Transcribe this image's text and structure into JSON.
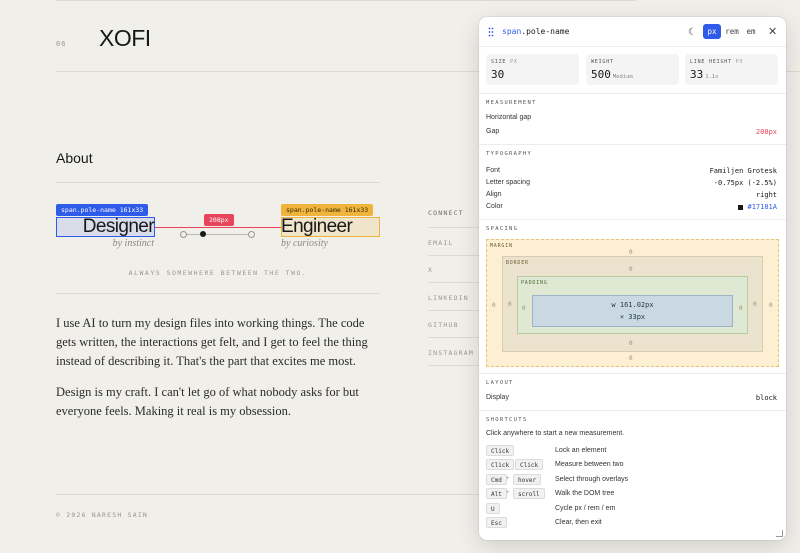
{
  "page": {
    "issue": "06",
    "logo": "XOFI",
    "section_title": "About",
    "designer": {
      "tag": "span.pole-name 161x33",
      "name": "Designer",
      "sub": "by instinct"
    },
    "engineer": {
      "tag": "span.pole-name 161x33",
      "name": "Engineer",
      "sub": "by curiosity"
    },
    "gap_label": "208px",
    "always_text": "ALWAYS SOMEWHERE BETWEEN THE TWO.",
    "paragraphs": [
      "I use AI to turn my design files into working things. The code gets written, the interactions get felt, and I get to feel the thing instead of describing it. That's the part that excites me most.",
      "Design is my craft. I can't let go of what nobody asks for but everyone feels. Making it real is my obsession."
    ],
    "connect": {
      "heading": "CONNECT",
      "items": [
        "EMAIL",
        "X",
        "LINKEDIN",
        "GITHUB",
        "INSTAGRAM"
      ]
    },
    "footer": "© 2026 NARESH SAIN"
  },
  "panel": {
    "title_prefix": "span",
    "title_class": ".pole-name",
    "units": [
      "px",
      "rem",
      "em"
    ],
    "active_unit": "px",
    "stats": [
      {
        "label": "SIZE",
        "unit": "PX",
        "value": "30",
        "sub": ""
      },
      {
        "label": "WEIGHT",
        "unit": "",
        "value": "500",
        "sub": "Medium"
      },
      {
        "label": "LINE HEIGHT",
        "unit": "PX",
        "value": "33",
        "sub": "1.1x"
      }
    ],
    "measurement": {
      "heading": "MEASUREMENT",
      "mode": "Horizontal gap",
      "gap_key": "Gap",
      "gap_value": "208px"
    },
    "typography": {
      "heading": "TYPOGRAPHY",
      "rows": [
        {
          "key": "Font",
          "value": "Familjen Grotesk"
        },
        {
          "key": "Letter spacing",
          "value": "-0.75px (-2.5%)"
        },
        {
          "key": "Align",
          "value": "right"
        },
        {
          "key": "Color",
          "value": "#17181A"
        }
      ]
    },
    "spacing": {
      "heading": "SPACING",
      "margin_label": "MARGIN",
      "border_label": "BORDER",
      "padding_label": "PADDING",
      "zero": "0",
      "content_w": "w 161.02px",
      "content_h": "× 33px"
    },
    "layout": {
      "heading": "LAYOUT",
      "key": "Display",
      "value": "block"
    },
    "shortcuts": {
      "heading": "SHORTCUTS",
      "intro": "Click anywhere to start a new measurement.",
      "items": [
        {
          "keys": [
            "Click"
          ],
          "desc": "Lock an element"
        },
        {
          "keys": [
            "Click",
            "Click"
          ],
          "desc": "Measure between two"
        },
        {
          "keys": [
            "Cmd",
            "hover"
          ],
          "desc": "Select through overlays"
        },
        {
          "keys": [
            "Alt",
            "scroll"
          ],
          "desc": "Walk the DOM tree"
        },
        {
          "keys": [
            "U"
          ],
          "desc": "Cycle px / rem / em"
        },
        {
          "keys": [
            "Esc"
          ],
          "desc": "Clear, then exit"
        }
      ]
    }
  },
  "colors": {
    "background": "#f1efea",
    "ink": "#17181a",
    "accent": "#2f5bea",
    "gap": "#e8455a",
    "highlight": "#f0b43c"
  },
  "icons": [
    "drag-handle-icon",
    "moon-icon",
    "close-icon",
    "resize-handle-icon"
  ]
}
